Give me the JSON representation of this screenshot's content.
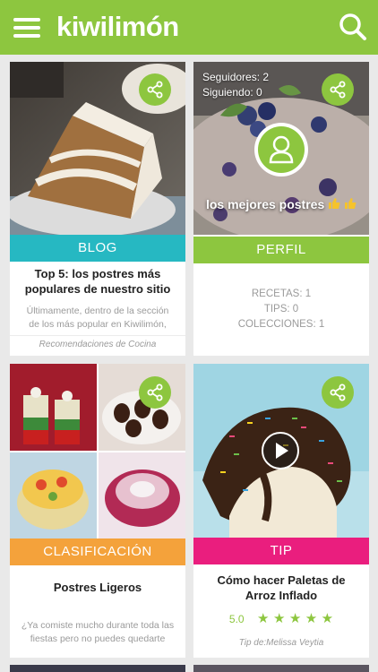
{
  "app": {
    "logo_text": "kiwilimón"
  },
  "colors": {
    "brand_green": "#8dc63f",
    "blog_teal": "#26b8c2",
    "tip_pink": "#ea1e7e",
    "category_orange": "#f4a23b"
  },
  "cards": [
    {
      "type_label": "BLOG",
      "title": "Top 5: los postres más populares de nuestro sitio",
      "excerpt": "Últimamente, dentro de la sección de los más popular en Kiwilimón, han…",
      "footer": "Recomendaciones de Cocina"
    },
    {
      "type_label": "PERFIL",
      "followers": "Seguidores: 2",
      "following": "Siguiendo: 0",
      "profile_name": "los mejores postres",
      "stats": [
        "RECETAS: 1",
        "TIPS: 0",
        "COLECCIONES: 1"
      ]
    },
    {
      "type_label": "CLASIFICACIÓN",
      "title": "Postres Ligeros",
      "excerpt": "¿Ya comiste mucho durante toda las fiestas pero no puedes quedarte co…"
    },
    {
      "type_label": "TIP",
      "title": "Cómo hacer Paletas de Arroz Inflado",
      "rating": "5.0",
      "rating_stars": 5,
      "footer": "Tip de:Melissa  Veytia"
    }
  ],
  "icons": {
    "menu": "hamburger-menu-icon",
    "search": "search-icon",
    "share": "share-icon",
    "play": "play-icon",
    "user": "user-icon",
    "thumb": "thumbs-up-icon",
    "star": "star-icon"
  }
}
